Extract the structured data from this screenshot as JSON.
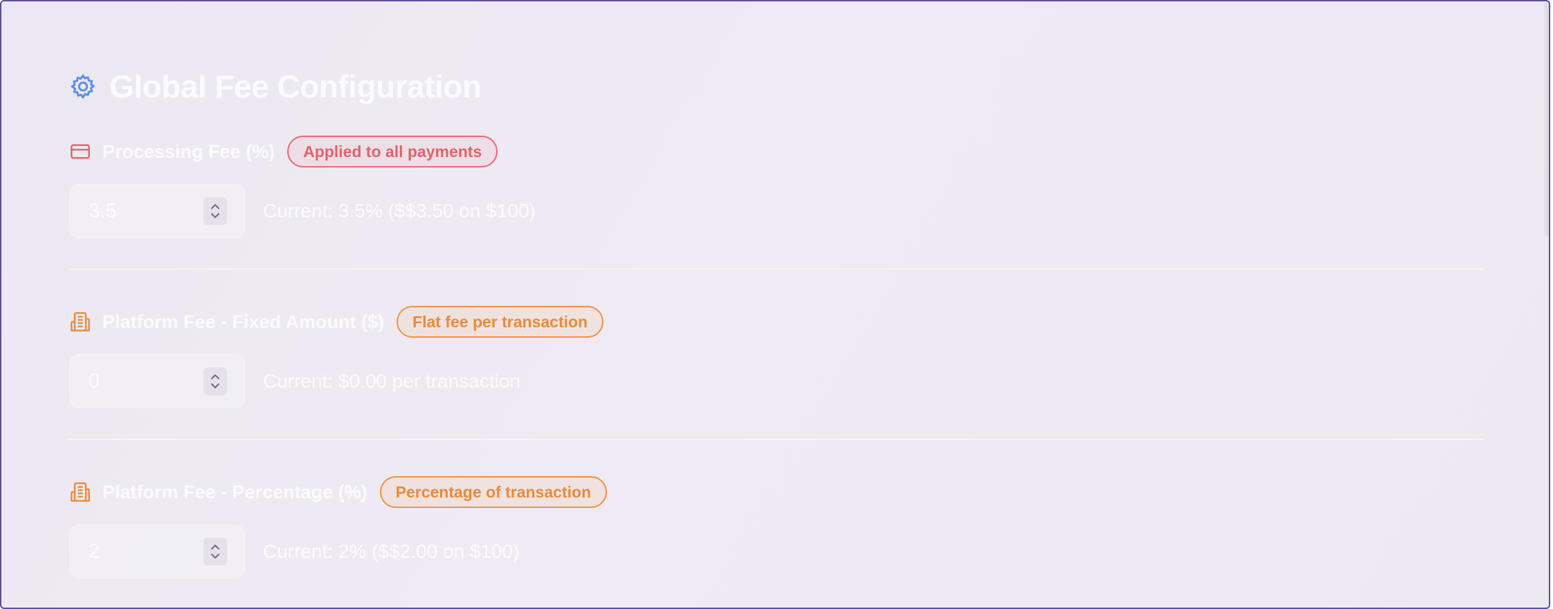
{
  "header": {
    "title": "Global Fee Configuration",
    "icon": "gear-icon"
  },
  "colors": {
    "accent_blue": "#5b8def",
    "badge_red": "#e0636b",
    "badge_orange": "#ea8a3c",
    "panel_border": "#5b4f9e"
  },
  "fields": [
    {
      "label": "Processing Fee (%)",
      "icon": "credit-card-icon",
      "badge": "Applied to all payments",
      "value": "3.5",
      "current": "Current: 3.5% ($$3.50 on $100)"
    },
    {
      "label": "Platform Fee - Fixed Amount ($)",
      "icon": "building-icon",
      "badge": "Flat fee per transaction",
      "value": "0",
      "current": "Current: $0.00 per transaction"
    },
    {
      "label": "Platform Fee - Percentage (%)",
      "icon": "building-icon",
      "badge": "Percentage of transaction",
      "value": "2",
      "current": "Current: 2% ($$2.00 on $100)"
    }
  ]
}
